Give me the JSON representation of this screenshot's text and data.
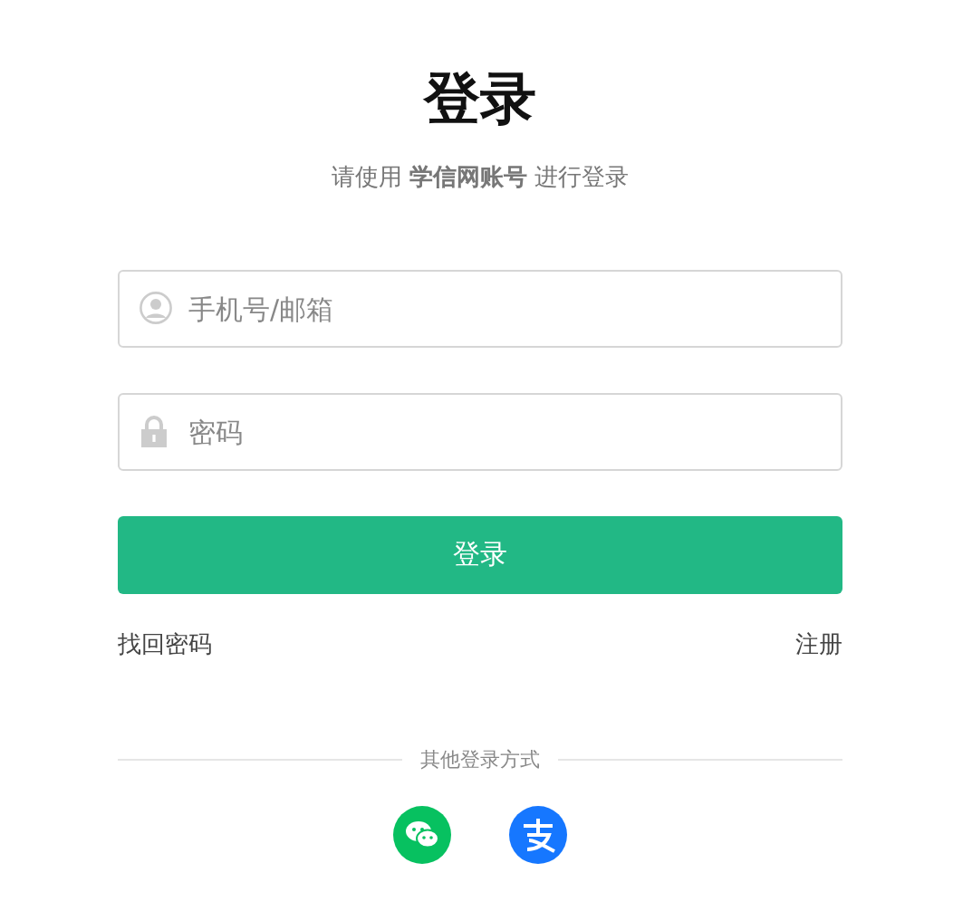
{
  "title": "登录",
  "subtitle": "请使用 **学信网账号** 进行登录",
  "fields": [
    {
      "kind": "user",
      "placeholder": "手机号/邮箱"
    },
    {
      "kind": "password",
      "placeholder": "密码"
    }
  ],
  "submit": "登录",
  "links": {
    "left": "找回密码",
    "right": "注册"
  },
  "other_login": {
    "label": "其他登录方式",
    "options": [
      {
        "kind": "wechat",
        "color": "#07c160"
      },
      {
        "kind": "alipay",
        "color": "#1677ff"
      }
    ]
  }
}
